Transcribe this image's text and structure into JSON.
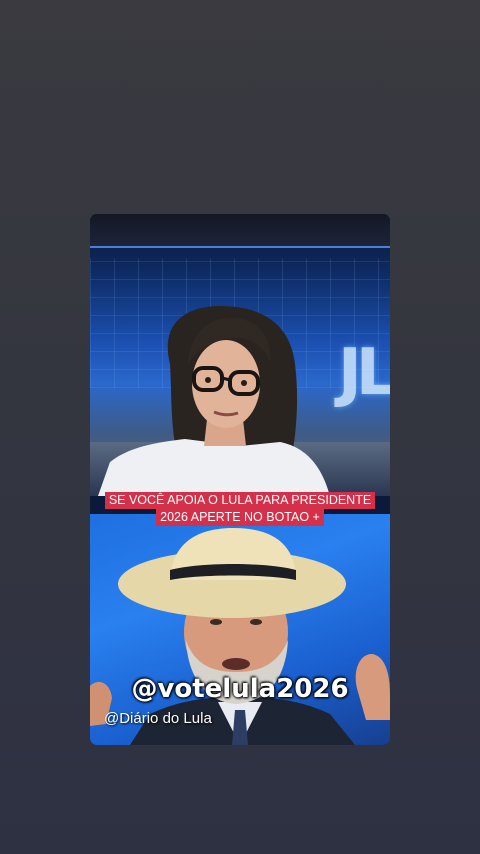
{
  "video": {
    "caption_line1": "SE VOCÊ APOIA O LULA PARA PRESIDENTE",
    "caption_line2": "2026 APERTE NO BOTAO +",
    "handle": "@votelula2026",
    "watermark": "@Diário do Lula",
    "studio_logo": "JL"
  },
  "colors": {
    "background": "#34363f",
    "caption_background": "#d4304a",
    "studio_blue": "#1b4fb0"
  }
}
